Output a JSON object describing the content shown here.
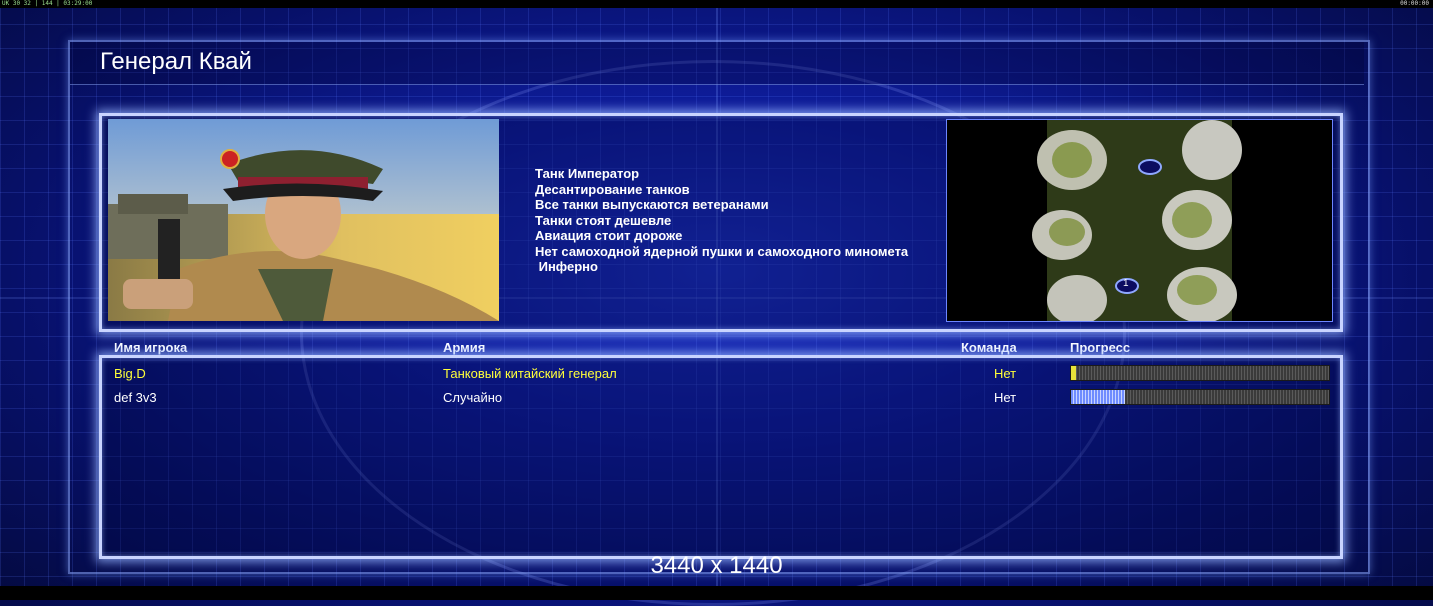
{
  "status_left": "UK 30 32 | 144 | 03:29:00",
  "status_right": "00:00:00",
  "title": "Генерал Квай",
  "features": [
    "Танк Император",
    "Десантирование танков",
    "Все танки выпускаются ветеранами",
    "Танки стоят дешевле",
    "Авиация стоит дороже",
    "Нет самоходной ядерной пушки и самоходного миномета",
    " Инферно"
  ],
  "map_marker": "1",
  "headers": {
    "player": "Имя игрока",
    "army": "Армия",
    "team": "Команда",
    "progress": "Прогресс"
  },
  "players": [
    {
      "name": "Big.D",
      "army": "Танковый китайский генерал",
      "team": "Нет",
      "progress": 0.02
    },
    {
      "name": "def 3v3",
      "army": "Случайно",
      "team": "Нет",
      "progress": 0.21
    }
  ],
  "resolution": "3440 x 1440",
  "colors": {
    "yellow_text": "#ffff3a",
    "panel_border": "#c9d4ff",
    "progress_yellow": "#e8e23a",
    "progress_blue": "#6f8cff"
  }
}
